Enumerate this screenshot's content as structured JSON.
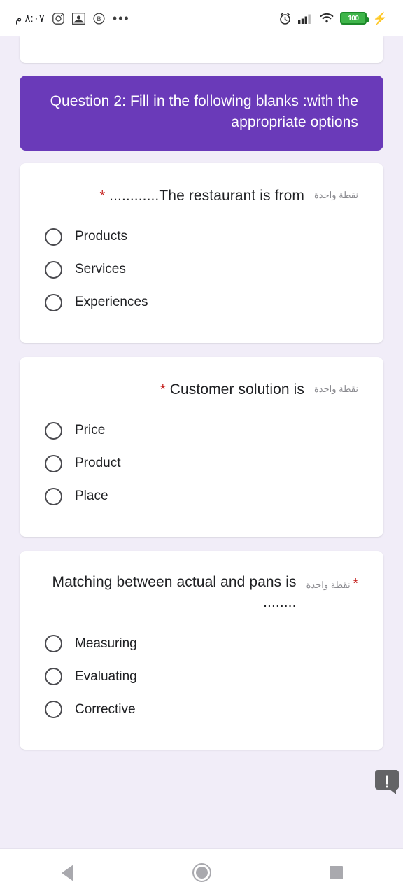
{
  "status_bar": {
    "charging_icon": "lightning-bolt-icon",
    "battery_level": "100",
    "wifi_icon": "wifi-icon",
    "signal_icon": "cellular-signal-icon",
    "alarm_icon": "alarm-clock-icon",
    "overflow_icon": "more-dots-icon",
    "app_icons": [
      "bolt-app-icon",
      "gallery-app-icon",
      "instagram-app-icon"
    ],
    "time": "٨:٠٧ م"
  },
  "banner": {
    "text": "Question 2: Fill in the following blanks :with the appropriate options"
  },
  "questions": [
    {
      "title": "The restaurant is from............",
      "required_mark": "*",
      "points": "نقطة واحدة",
      "options": [
        "Products",
        "Services",
        "Experiences"
      ]
    },
    {
      "title": "Customer solution is",
      "required_mark": "*",
      "points": "نقطة واحدة",
      "options": [
        "Price",
        "Product",
        "Place"
      ]
    },
    {
      "title": "Matching between actual and pans is ........",
      "required_mark": "*",
      "points": "نقطة واحدة",
      "options": [
        "Measuring",
        "Evaluating",
        "Corrective"
      ]
    }
  ],
  "floating_bubble": {
    "icon": "exclamation-bubble-icon"
  },
  "nav_bar": {
    "recents_label": "recents-button",
    "home_label": "home-button",
    "back_label": "back-button"
  },
  "colors": {
    "banner_purple": "#6a3ab9",
    "page_background": "#f1edf8",
    "required_red": "#c5221f",
    "card_white": "#ffffff"
  }
}
